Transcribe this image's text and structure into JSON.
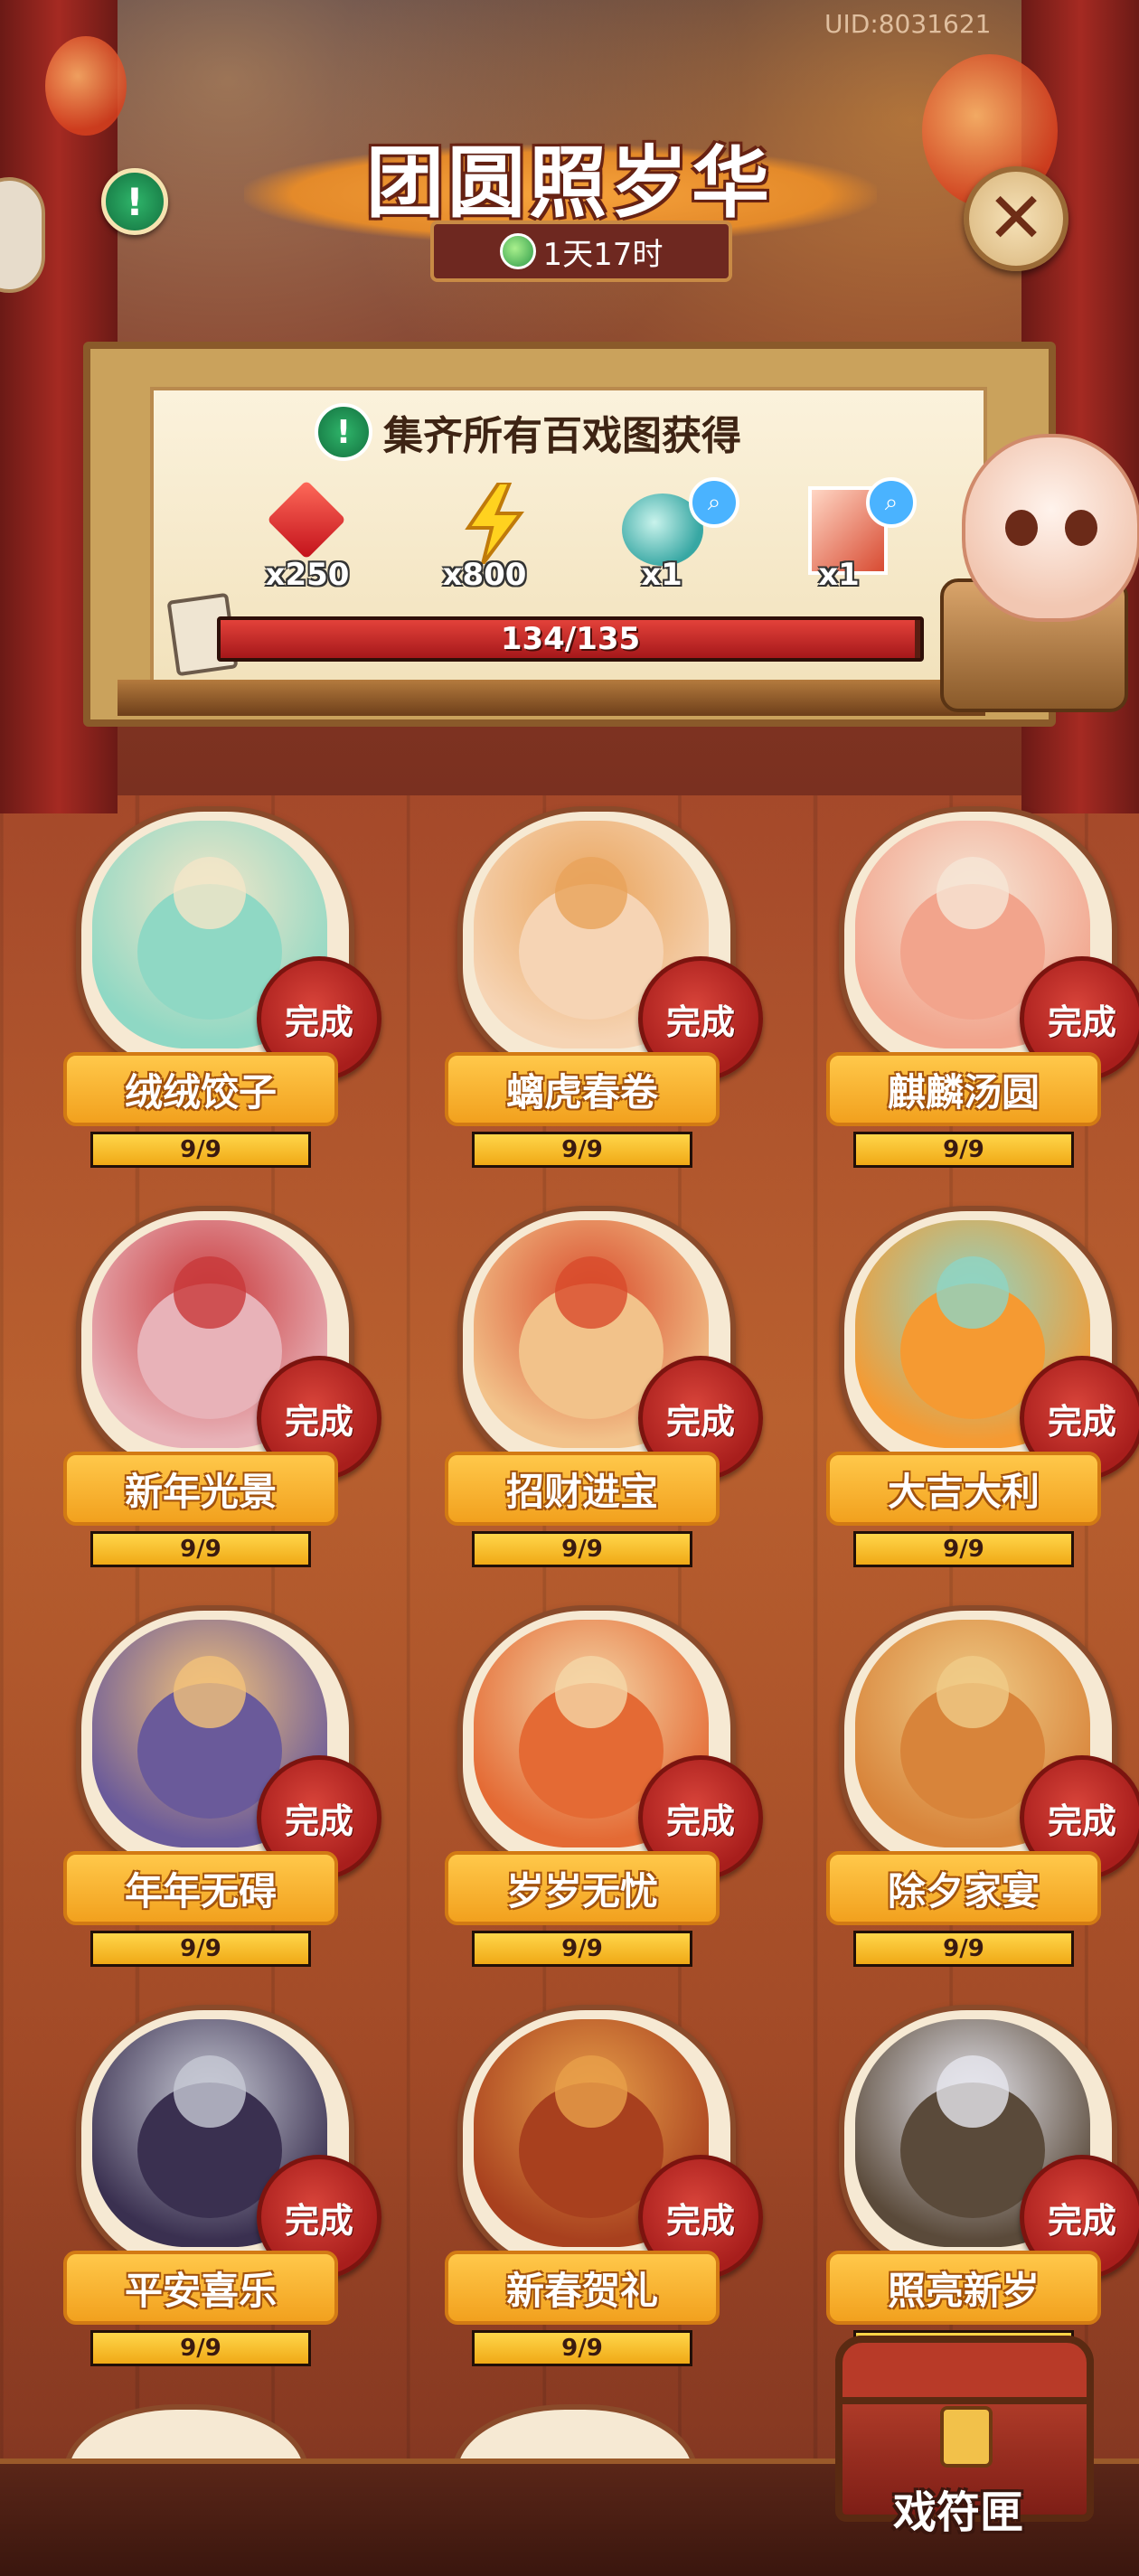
{
  "header": {
    "uid": "UID:8031621",
    "title": "团圆照岁华",
    "timer": "1天17时",
    "icons": [
      "info-icon",
      "close-icon",
      "timer-drop-icon"
    ]
  },
  "reward_panel": {
    "requirement": "集齐所有百戏图获得",
    "rewards": [
      {
        "icon": "red-gem-icon",
        "count": "x250"
      },
      {
        "icon": "lightning-icon",
        "count": "x800"
      },
      {
        "icon": "spirit-orb-icon",
        "count": "x1"
      },
      {
        "icon": "portrait-card-icon",
        "count": "x1"
      }
    ],
    "progress": {
      "current": 134,
      "total": 135,
      "text": "134/135"
    }
  },
  "cards": [
    {
      "name": "绒绒饺子",
      "status": "完成",
      "progress": "9/9",
      "fill": 1.0,
      "colors": [
        "#8fd8c4",
        "#f4e6c8"
      ]
    },
    {
      "name": "螭虎春卷",
      "status": "完成",
      "progress": "9/9",
      "fill": 1.0,
      "colors": [
        "#f6d4b4",
        "#e9a35a"
      ]
    },
    {
      "name": "麒麟汤圆",
      "status": "完成",
      "progress": "9/9",
      "fill": 1.0,
      "colors": [
        "#f2a48c",
        "#f6e6d6"
      ]
    },
    {
      "name": "新年光景",
      "status": "完成",
      "progress": "9/9",
      "fill": 1.0,
      "colors": [
        "#e8b2b8",
        "#c8383a"
      ]
    },
    {
      "name": "招财进宝",
      "status": "完成",
      "progress": "9/9",
      "fill": 1.0,
      "colors": [
        "#f2c28a",
        "#d84a2a"
      ]
    },
    {
      "name": "大吉大利",
      "status": "完成",
      "progress": "9/9",
      "fill": 1.0,
      "colors": [
        "#f59a32",
        "#8fd4c4"
      ]
    },
    {
      "name": "年年无碍",
      "status": "完成",
      "progress": "9/9",
      "fill": 1.0,
      "colors": [
        "#6a5a9a",
        "#f3c27a"
      ]
    },
    {
      "name": "岁岁无忧",
      "status": "完成",
      "progress": "9/9",
      "fill": 1.0,
      "colors": [
        "#e46a34",
        "#f5d7a8"
      ]
    },
    {
      "name": "除夕家宴",
      "status": "完成",
      "progress": "9/9",
      "fill": 1.0,
      "colors": [
        "#d8843a",
        "#f0cc88"
      ]
    },
    {
      "name": "平安喜乐",
      "status": "完成",
      "progress": "9/9",
      "fill": 1.0,
      "colors": [
        "#3a3050",
        "#c7c9d4"
      ]
    },
    {
      "name": "新春贺礼",
      "status": "完成",
      "progress": "9/9",
      "fill": 1.0,
      "colors": [
        "#a8401e",
        "#e8a04a"
      ]
    },
    {
      "name": "照亮新岁",
      "status": "完成",
      "progress": "9/9",
      "fill": 1.0,
      "colors": [
        "#5a4a3a",
        "#e6e6ee"
      ]
    }
  ],
  "chest": {
    "label": "戏符匣",
    "icon": "treasure-chest-icon"
  }
}
